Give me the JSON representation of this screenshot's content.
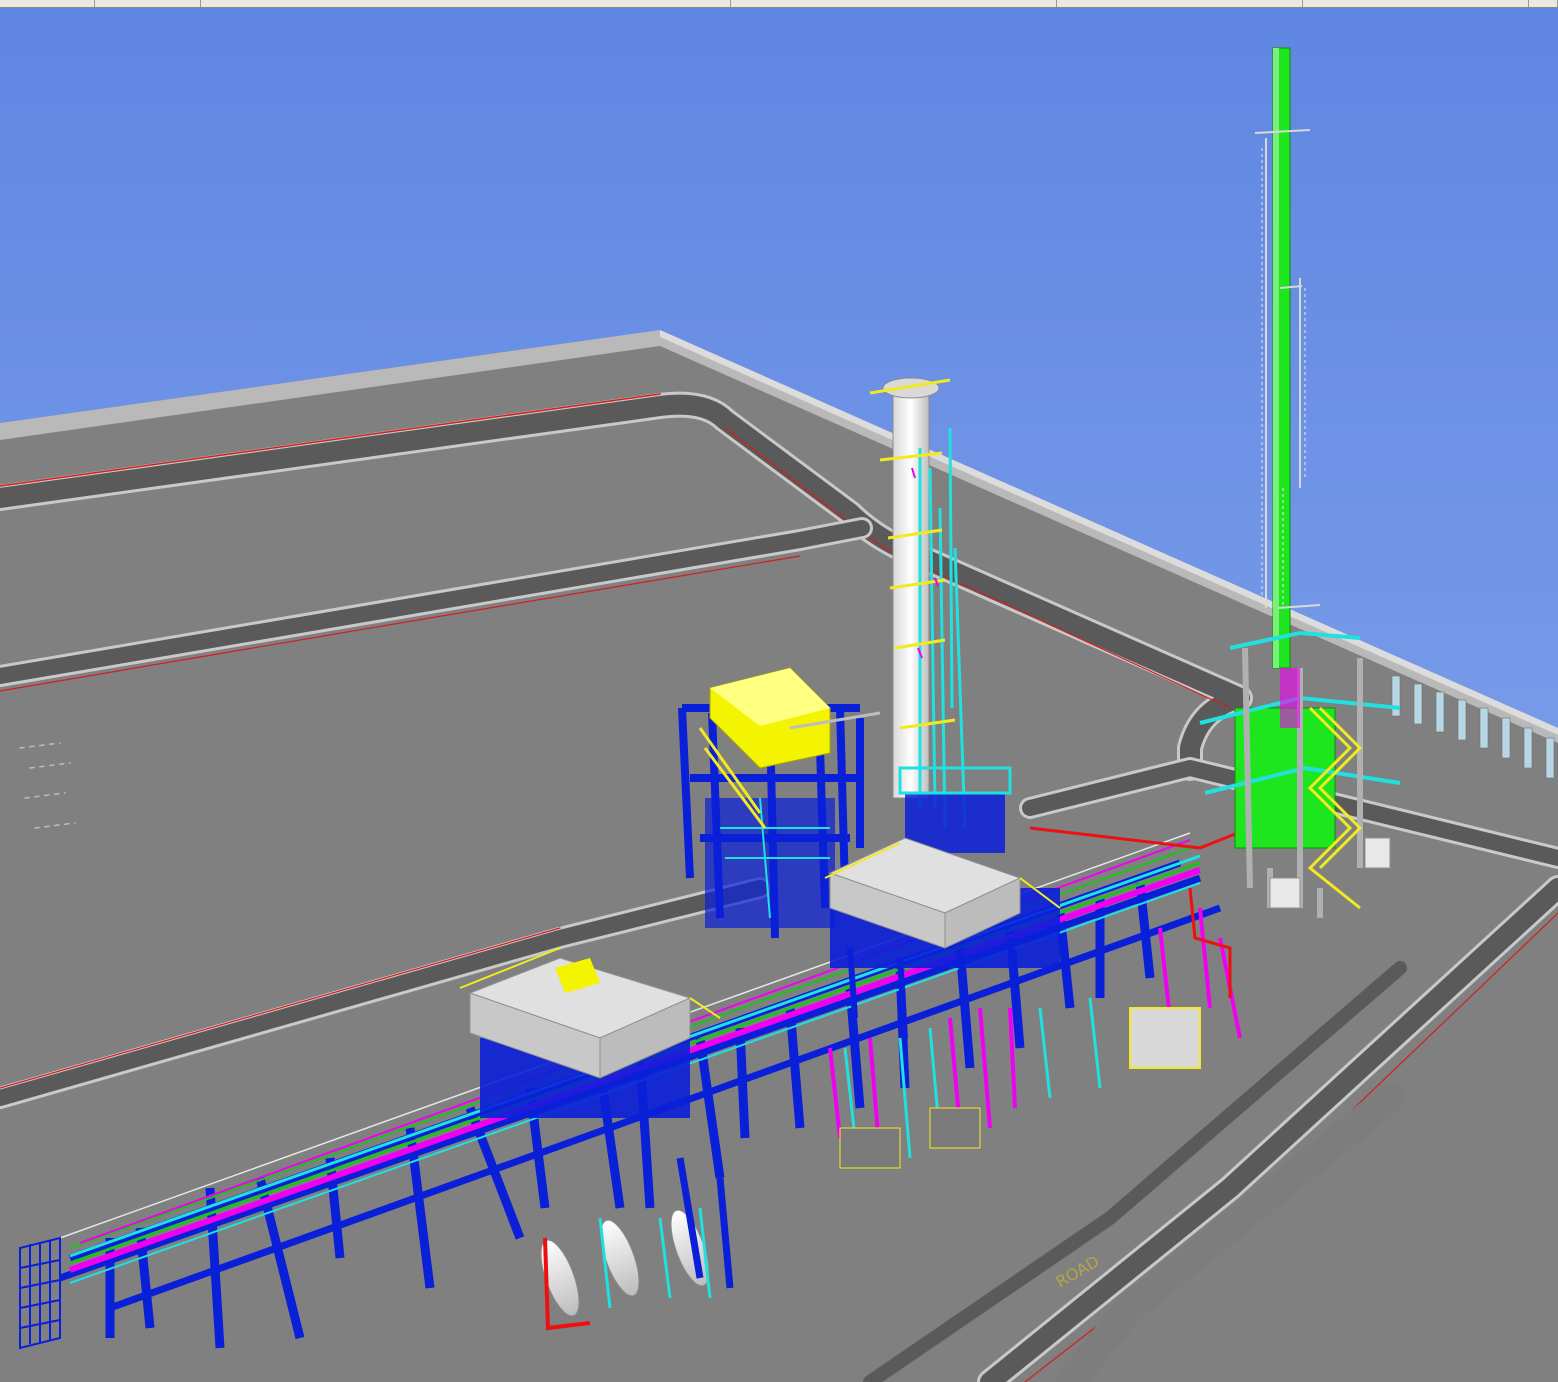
{
  "window": {
    "title": ""
  },
  "viewport": {
    "sky_top": "#5f86e2",
    "sky_bottom": "#8cadee",
    "ground": "#808080",
    "road": "#575757",
    "curb": "#c8c8c8",
    "road_line": "#d82020",
    "steel": "#0a1fd8",
    "flare_stack": "#1ee61e",
    "pipe_magenta": "#f000f0",
    "pipe_cyan": "#20e0e0",
    "pipe_green": "#20c020",
    "pipe_red": "#ee1010",
    "handrail": "#f2ea20",
    "equipment": "#e6e6e6",
    "cooler_box": "#f4f400"
  },
  "ground_label": "ROAD"
}
